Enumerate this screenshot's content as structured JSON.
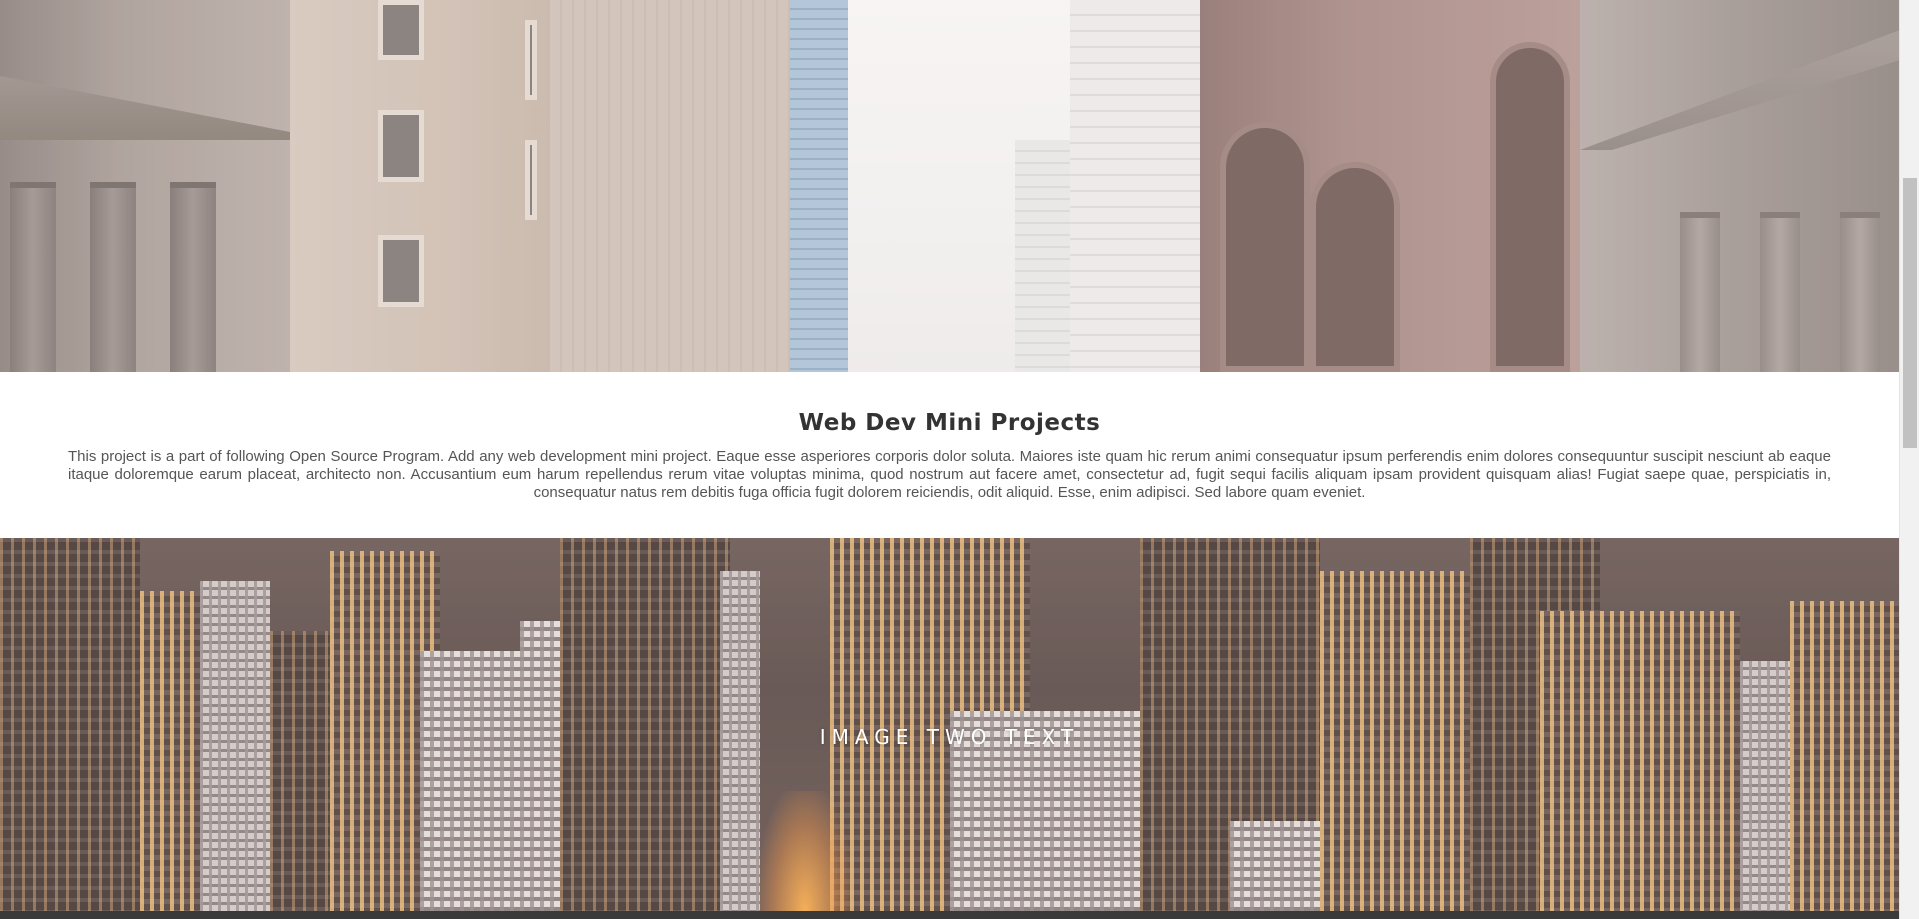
{
  "section_one": {
    "image_alt": "Street between city buildings"
  },
  "content": {
    "heading": "Web Dev Mini Projects",
    "paragraph": "This project is a part of following Open Source Program. Add any web development mini project. Eaque esse asperiores corporis dolor soluta. Maiores iste quam hic rerum animi consequatur ipsum perferendis enim dolores consequuntur suscipit nesciunt ab eaque itaque doloremque earum placeat, architecto non. Accusantium eum harum repellendus rerum vitae voluptas minima, quod nostrum aut facere amet, consectetur ad, fugit sequi facilis aliquam ipsam provident quisquam alias! Fugiat saepe quae, perspiciatis in, consequatur natus rem debitis fuga officia fugit dolorem reiciendis, odit aliquid. Esse, enim adipisci. Sed labore quam eveniet."
  },
  "section_two": {
    "overlay_text": "IMAGE TWO TEXT"
  },
  "scrollbar": {
    "position": 0.22
  }
}
